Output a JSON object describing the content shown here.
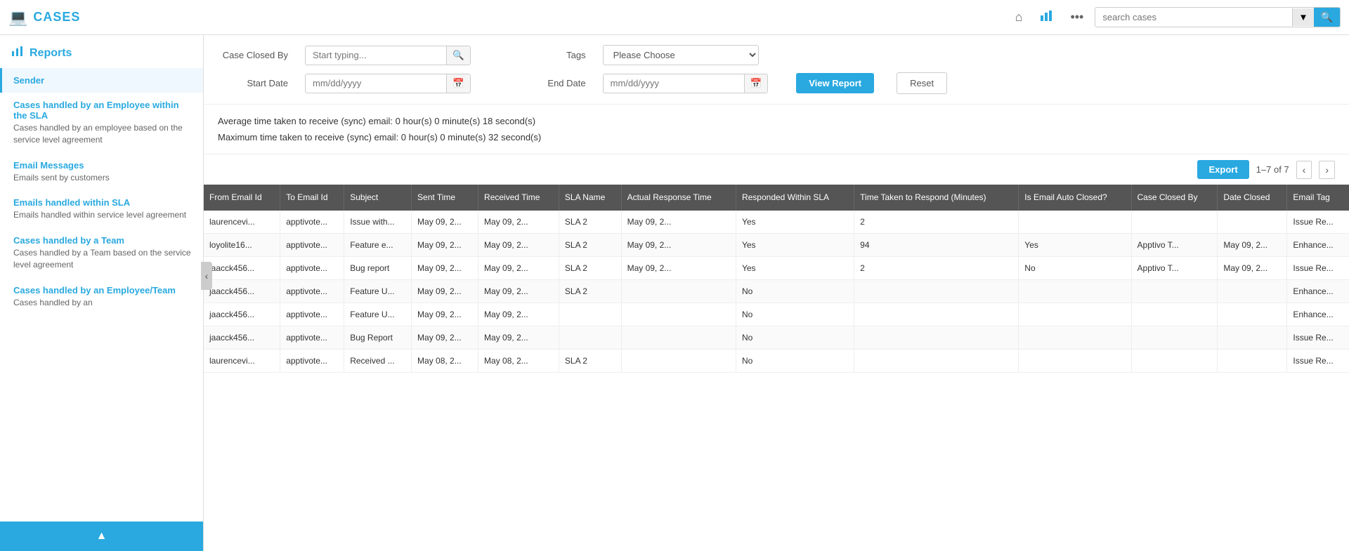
{
  "app": {
    "title": "CASES",
    "logo_char": "?"
  },
  "topnav": {
    "home_icon": "⌂",
    "chart_icon": "▮▮",
    "more_icon": "•••",
    "search_placeholder": "search cases",
    "dropdown_icon": "▼",
    "search_icon": "🔍"
  },
  "sidebar": {
    "title": "Reports",
    "icon": "▮▮",
    "items": [
      {
        "id": "sender",
        "title": "Sender",
        "desc": "",
        "active": true
      },
      {
        "id": "cases-employee-sla",
        "title": "Cases handled by an Employee within the SLA",
        "desc": "Cases handled by an employee based on the service level agreement",
        "active": false
      },
      {
        "id": "email-messages",
        "title": "Email Messages",
        "desc": "Emails sent by customers",
        "active": false
      },
      {
        "id": "emails-within-sla",
        "title": "Emails handled within SLA",
        "desc": "Emails handled within service level agreement",
        "active": false
      },
      {
        "id": "cases-by-team",
        "title": "Cases handled by a Team",
        "desc": "Cases handled by a Team based on the service level agreement",
        "active": false
      },
      {
        "id": "cases-employee-team",
        "title": "Cases handled by an Employee/Team",
        "desc": "Cases handled by an",
        "active": false
      }
    ],
    "scroll_up_label": "▲"
  },
  "filters": {
    "case_closed_by_label": "Case Closed By",
    "case_closed_by_placeholder": "Start typing...",
    "case_closed_by_icon": "🔍",
    "tags_label": "Tags",
    "tags_placeholder": "Please Choose",
    "tags_options": [
      "Please Choose"
    ],
    "start_date_label": "Start Date",
    "start_date_placeholder": "mm/dd/yyyy",
    "end_date_label": "End Date",
    "end_date_placeholder": "mm/dd/yyyy",
    "view_report_label": "View Report",
    "reset_label": "Reset"
  },
  "stats": {
    "average_line": "Average time taken to receive (sync) email: 0 hour(s) 0 minute(s) 18 second(s)",
    "maximum_line": "Maximum time taken to receive (sync) email: 0 hour(s) 0 minute(s) 32 second(s)"
  },
  "table_controls": {
    "export_label": "Export",
    "pagination_info": "1–7 of 7",
    "prev_icon": "‹",
    "next_icon": "›"
  },
  "table": {
    "columns": [
      "From Email Id",
      "To Email Id",
      "Subject",
      "Sent Time",
      "Received Time",
      "SLA Name",
      "Actual Response Time",
      "Responded Within SLA",
      "Time Taken to Respond (Minutes)",
      "Is Email Auto Closed?",
      "Case Closed By",
      "Date Closed",
      "Email Tag"
    ],
    "rows": [
      {
        "from_email": "laurencevi...",
        "to_email": "apptivote...",
        "subject": "Issue with...",
        "sent_time": "May 09, 2...",
        "received_time": "May 09, 2...",
        "sla_name": "SLA 2",
        "actual_response": "May 09, 2...",
        "responded_within": "Yes",
        "time_taken": "2",
        "is_auto_closed": "",
        "case_closed_by": "",
        "date_closed": "",
        "email_tag": "Issue Re..."
      },
      {
        "from_email": "loyolite16...",
        "to_email": "apptivote...",
        "subject": "Feature e...",
        "sent_time": "May 09, 2...",
        "received_time": "May 09, 2...",
        "sla_name": "SLA 2",
        "actual_response": "May 09, 2...",
        "responded_within": "Yes",
        "time_taken": "94",
        "is_auto_closed": "Yes",
        "case_closed_by": "Apptivo T...",
        "date_closed": "May 09, 2...",
        "email_tag": "Enhance..."
      },
      {
        "from_email": "jaacck456...",
        "to_email": "apptivote...",
        "subject": "Bug report",
        "sent_time": "May 09, 2...",
        "received_time": "May 09, 2...",
        "sla_name": "SLA 2",
        "actual_response": "May 09, 2...",
        "responded_within": "Yes",
        "time_taken": "2",
        "is_auto_closed": "No",
        "case_closed_by": "Apptivo T...",
        "date_closed": "May 09, 2...",
        "email_tag": "Issue Re..."
      },
      {
        "from_email": "jaacck456...",
        "to_email": "apptivote...",
        "subject": "Feature U...",
        "sent_time": "May 09, 2...",
        "received_time": "May 09, 2...",
        "sla_name": "SLA 2",
        "actual_response": "",
        "responded_within": "No",
        "time_taken": "",
        "is_auto_closed": "",
        "case_closed_by": "",
        "date_closed": "",
        "email_tag": "Enhance..."
      },
      {
        "from_email": "jaacck456...",
        "to_email": "apptivote...",
        "subject": "Feature U...",
        "sent_time": "May 09, 2...",
        "received_time": "May 09, 2...",
        "sla_name": "",
        "actual_response": "",
        "responded_within": "No",
        "time_taken": "",
        "is_auto_closed": "",
        "case_closed_by": "",
        "date_closed": "",
        "email_tag": "Enhance..."
      },
      {
        "from_email": "jaacck456...",
        "to_email": "apptivote...",
        "subject": "Bug Report",
        "sent_time": "May 09, 2...",
        "received_time": "May 09, 2...",
        "sla_name": "",
        "actual_response": "",
        "responded_within": "No",
        "time_taken": "",
        "is_auto_closed": "",
        "case_closed_by": "",
        "date_closed": "",
        "email_tag": "Issue Re..."
      },
      {
        "from_email": "laurencevi...",
        "to_email": "apptivote...",
        "subject": "Received ...",
        "sent_time": "May 08, 2...",
        "received_time": "May 08, 2...",
        "sla_name": "SLA 2",
        "actual_response": "",
        "responded_within": "No",
        "time_taken": "",
        "is_auto_closed": "",
        "case_closed_by": "",
        "date_closed": "",
        "email_tag": "Issue Re..."
      }
    ]
  }
}
